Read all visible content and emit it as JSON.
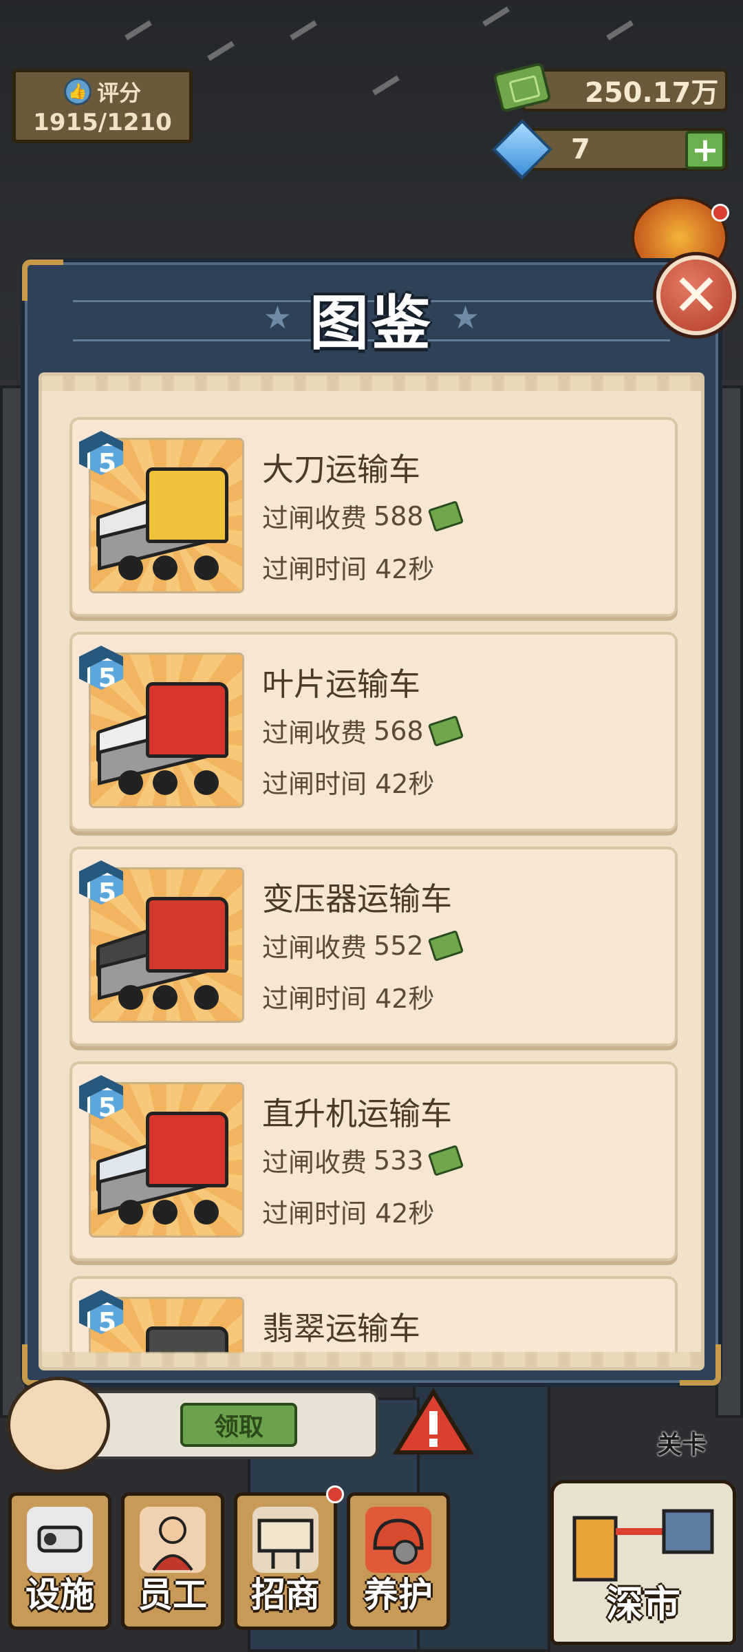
{
  "hud": {
    "score_label": "评分",
    "score_value": "1915/1210",
    "money": "250.17万",
    "gems": "7",
    "plus_symbol": "+"
  },
  "modal": {
    "title": "图鉴",
    "close_symbol": "✕",
    "star_symbol": "★"
  },
  "items": [
    {
      "level": "5",
      "name": "大刀运输车",
      "fee_label": "过闸收费",
      "fee": "588",
      "time_label": "过闸时间",
      "time": "42秒",
      "cab_color": "#f2c23a",
      "load_color": "#e8e8e8"
    },
    {
      "level": "5",
      "name": "叶片运输车",
      "fee_label": "过闸收费",
      "fee": "568",
      "time_label": "过闸时间",
      "time": "42秒",
      "cab_color": "#d8362c",
      "load_color": "#eeeeee"
    },
    {
      "level": "5",
      "name": "变压器运输车",
      "fee_label": "过闸收费",
      "fee": "552",
      "time_label": "过闸时间",
      "time": "42秒",
      "cab_color": "#d23a2e",
      "load_color": "#444444"
    },
    {
      "level": "5",
      "name": "直升机运输车",
      "fee_label": "过闸收费",
      "fee": "533",
      "time_label": "过闸时间",
      "time": "42秒",
      "cab_color": "#d8362c",
      "load_color": "#dfe6ee"
    },
    {
      "level": "5",
      "name": "翡翠运输车",
      "fee_label": "",
      "fee": "",
      "time_label": "",
      "time": "",
      "cab_color": "#4a4a4a",
      "load_color": "#ececec"
    }
  ],
  "bottom": {
    "claim_label": "领取",
    "level_label": "关卡",
    "nav": [
      {
        "label": "设施",
        "icon": "camera-icon",
        "badge": false
      },
      {
        "label": "员工",
        "icon": "staff-icon",
        "badge": false
      },
      {
        "label": "招商",
        "icon": "billboard-icon",
        "badge": true
      },
      {
        "label": "养护",
        "icon": "maintenance-icon",
        "badge": false
      }
    ],
    "city_label": "深市"
  },
  "colors": {
    "accent_blue": "#2e4156",
    "paper": "#efe2c8",
    "close_red": "#b33c2a",
    "badge_blue": "#5aa6dd"
  }
}
